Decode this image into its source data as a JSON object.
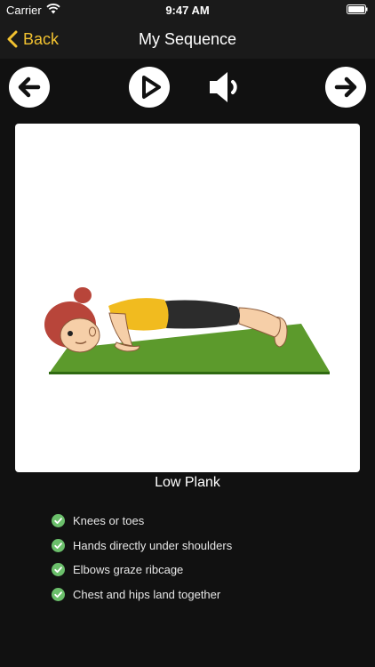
{
  "status_bar": {
    "carrier": "Carrier",
    "time": "9:47 AM"
  },
  "nav": {
    "back_label": "Back",
    "title": "My Sequence"
  },
  "controls": [
    {
      "icon": "arrow-left-icon"
    },
    {
      "icon": "play-icon"
    },
    {
      "icon": "speaker-icon"
    },
    {
      "icon": "arrow-right-icon"
    }
  ],
  "pose": {
    "name": "Low Plank",
    "image": "low-plank-illustration"
  },
  "tips": [
    "Knees or toes",
    "Hands directly under shoulders",
    "Elbows graze ribcage",
    "Chest and hips land together"
  ],
  "colors": {
    "accent": "#f2c230",
    "background": "#111111",
    "check": "#6bbf6b"
  }
}
